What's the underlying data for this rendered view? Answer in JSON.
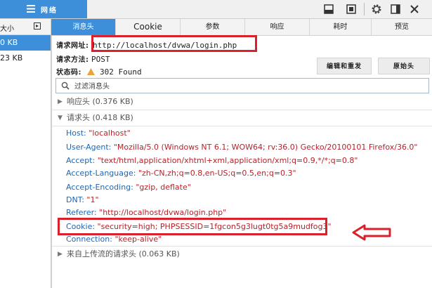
{
  "toolbar": {
    "network_label": "网络"
  },
  "left": {
    "header_label": "大小",
    "rows": [
      {
        "text": "0 KB",
        "selected": true
      },
      {
        "text": "23 KB",
        "selected": false
      }
    ]
  },
  "tabs": [
    {
      "label": "消息头",
      "active": true
    },
    {
      "label": "Cookie",
      "active": false
    },
    {
      "label": "参数",
      "active": false
    },
    {
      "label": "响应",
      "active": false
    },
    {
      "label": "耗时",
      "active": false
    },
    {
      "label": "预览",
      "active": false
    }
  ],
  "request": {
    "url_label": "请求网址:",
    "url_value": "http://localhost/dvwa/login.php",
    "method_label": "请求方法:",
    "method_value": "POST",
    "status_label": "状态码:",
    "status_value": "302 Found"
  },
  "buttons": {
    "edit_resend": "编辑和重发",
    "raw_headers": "原始头"
  },
  "filter": {
    "placeholder": "过滤消息头"
  },
  "sections": {
    "response_headers": "响应头 (0.376 KB)",
    "request_headers": "请求头 (0.418 KB)",
    "upload_headers": "来自上传流的请求头 (0.063 KB)"
  },
  "request_headers": [
    {
      "name": "Host:",
      "value": "\"localhost\""
    },
    {
      "name": "User-Agent:",
      "value": "\"Mozilla/5.0 (Windows NT 6.1; WOW64; rv:36.0) Gecko/20100101 Firefox/36.0\""
    },
    {
      "name": "Accept:",
      "value": "\"text/html,application/xhtml+xml,application/xml;q=0.9,*/*;q=0.8\""
    },
    {
      "name": "Accept-Language:",
      "value": "\"zh-CN,zh;q=0.8,en-US;q=0.5,en;q=0.3\""
    },
    {
      "name": "Accept-Encoding:",
      "value": "\"gzip, deflate\""
    },
    {
      "name": "DNT:",
      "value": "\"1\""
    },
    {
      "name": "Referer:",
      "value": "\"http://localhost/dvwa/login.php\""
    },
    {
      "name": "Cookie:",
      "value": "\"security=high; PHPSESSID=1fgcon5g3lugt0tg5a9mudfog3\""
    },
    {
      "name": "Connection:",
      "value": "\"keep-alive\""
    }
  ],
  "colors": {
    "accent": "#3c8fd8",
    "annotation_red": "#d9212c",
    "header_name": "#1d65b5",
    "header_value": "#b5232a",
    "status_warning": "#e8a33b"
  },
  "icons": [
    "list-icon",
    "dock-bottom-icon",
    "undock-icon",
    "gear-icon",
    "dock-side-icon",
    "close-icon",
    "search-icon",
    "left-arrow-icon"
  ]
}
